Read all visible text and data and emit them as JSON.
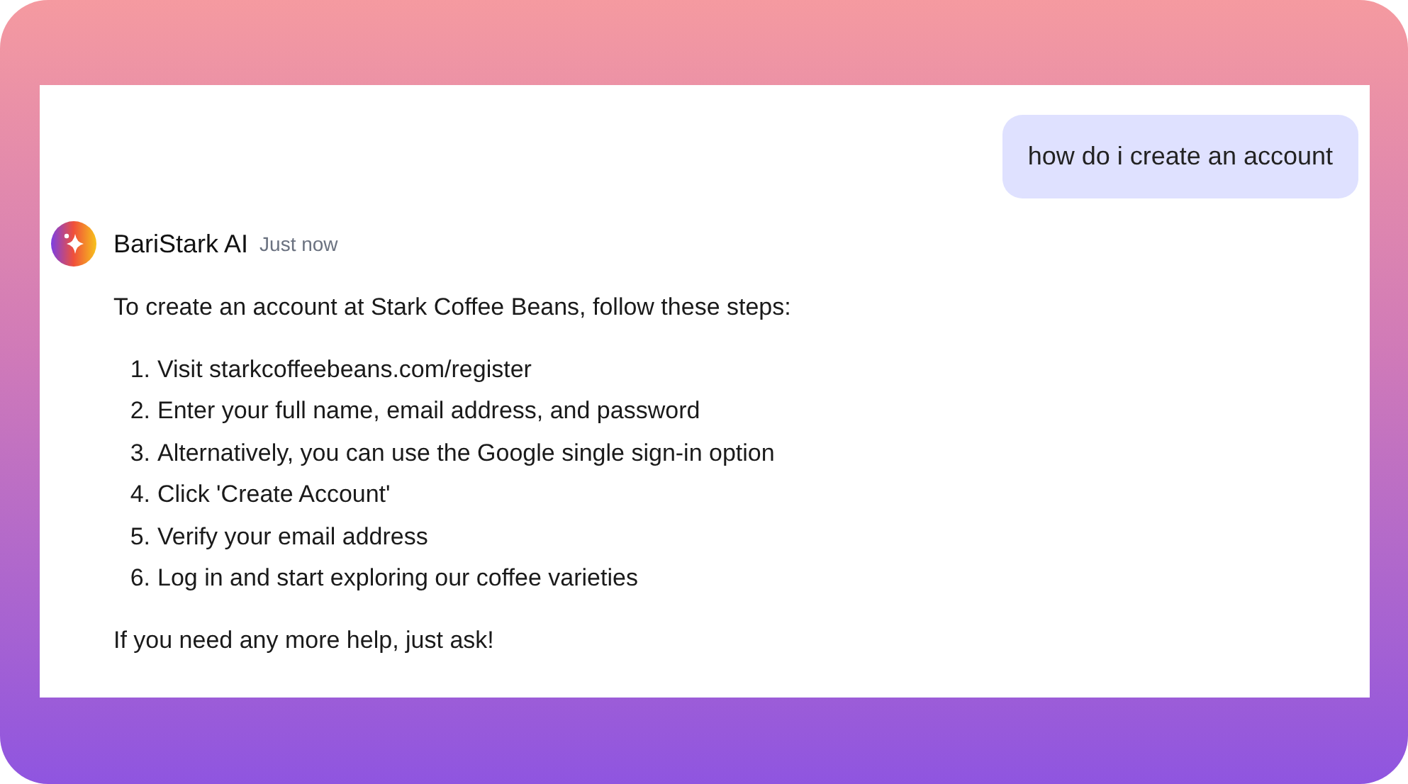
{
  "user_message": {
    "text": "how do i create an account"
  },
  "assistant": {
    "name": "BariStark AI",
    "time": "Just now",
    "intro": "To create an account at Stark Coffee Beans, follow these steps:",
    "steps": [
      {
        "number": "1.",
        "text": "Visit starkcoffeebeans.com/register"
      },
      {
        "number": "2.",
        "text": "Enter your full name, email address, and password"
      },
      {
        "number": "3.",
        "text": "Alternatively, you can use the Google single sign-in option"
      },
      {
        "number": "4.",
        "text": "Click 'Create Account'"
      },
      {
        "number": "5.",
        "text": "Verify your email address"
      },
      {
        "number": "6.",
        "text": "Log in and start exploring our coffee varieties"
      }
    ],
    "outro": "If you need any more help, just ask!"
  }
}
